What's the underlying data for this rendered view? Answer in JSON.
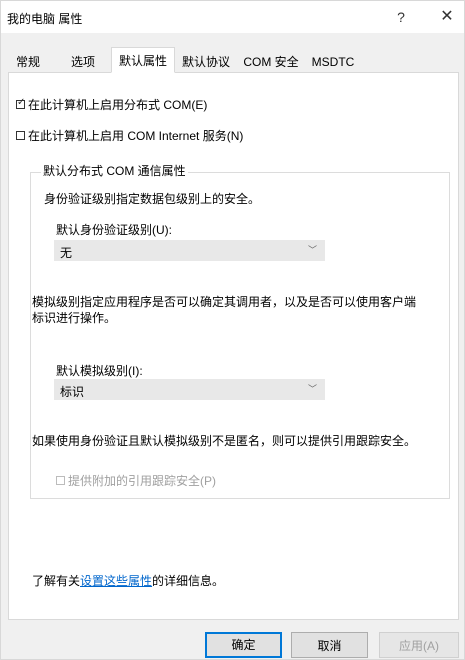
{
  "window": {
    "title": "我的电脑 属性",
    "help_label": "?",
    "close_label": "✕"
  },
  "tabs": [
    {
      "label": "常规"
    },
    {
      "label": "选项"
    },
    {
      "label": "默认属性"
    },
    {
      "label": "默认协议"
    },
    {
      "label": "COM 安全"
    },
    {
      "label": "MSDTC"
    }
  ],
  "options": {
    "enable_dcom": {
      "label": "在此计算机上启用分布式 COM(E)",
      "checked": true
    },
    "enable_com_internet": {
      "label": "在此计算机上启用 COM Internet 服务(N)",
      "checked": false
    }
  },
  "group": {
    "title": "默认分布式 COM 通信属性",
    "auth_desc": "身份验证级别指定数据包级别上的安全。",
    "auth_label": "默认身份验证级别(U):",
    "auth_value": "无",
    "impersonation_desc_line1": "模拟级别指定应用程序是否可以确定其调用者，以及是否可以使用客户端",
    "impersonation_desc_line2": "标识进行操作。",
    "impersonation_label": "默认模拟级别(I):",
    "impersonation_value": "标识",
    "reference_desc": "如果使用身份验证且默认模拟级别不是匿名，则可以提供引用跟踪安全。",
    "reference_checkbox": {
      "label": "提供附加的引用跟踪安全(P)",
      "checked": false,
      "enabled": false
    }
  },
  "footer": {
    "prefix": "了解有关",
    "link": "设置这些属性",
    "suffix": "的详细信息。"
  },
  "buttons": {
    "ok": "确定",
    "cancel": "取消",
    "apply": "应用(A)"
  }
}
